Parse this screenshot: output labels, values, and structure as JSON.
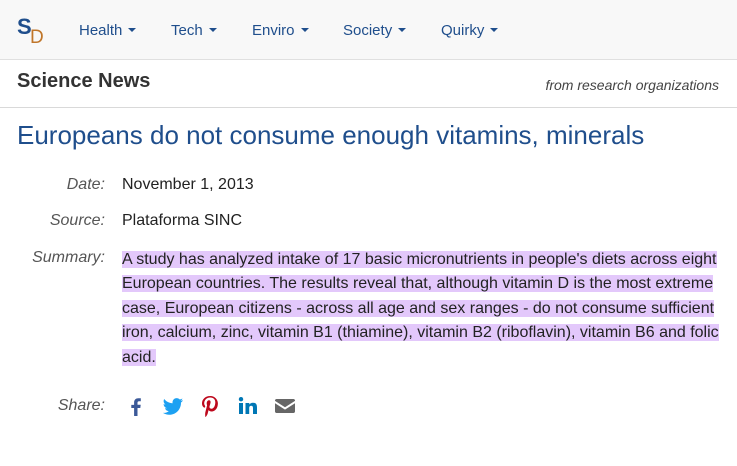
{
  "logo": {
    "letter_s": "S",
    "letter_d": "D"
  },
  "nav": {
    "items": [
      {
        "label": "Health"
      },
      {
        "label": "Tech"
      },
      {
        "label": "Enviro"
      },
      {
        "label": "Society"
      },
      {
        "label": "Quirky"
      }
    ]
  },
  "header": {
    "section_title": "Science News",
    "tagline": "from research organizations"
  },
  "article": {
    "headline": "Europeans do not consume enough vitamins, minerals",
    "date_label": "Date:",
    "date_value": "November 1, 2013",
    "source_label": "Source:",
    "source_value": "Plataforma SINC",
    "summary_label": "Summary:",
    "summary_value": "A study has analyzed intake of 17 basic micronutrients in people's diets across eight European countries. The results reveal that, although vitamin D is the most extreme case, European citizens - across all age and sex ranges - do not consume sufficient iron, calcium, zinc, vitamin B1 (thiamine), vitamin B2 (riboflavin), vitamin B6 and folic acid.",
    "share_label": "Share:"
  },
  "share": {
    "icons": [
      "facebook-icon",
      "twitter-icon",
      "pinterest-icon",
      "linkedin-icon",
      "email-icon"
    ]
  },
  "colors": {
    "brand_blue": "#1f4e8c",
    "logo_orange": "#c0762a",
    "highlight": "#e3c8fb",
    "facebook": "#3b5998",
    "twitter": "#1da1f2",
    "pinterest": "#bd081c",
    "linkedin": "#0077b5",
    "email": "#666666"
  }
}
